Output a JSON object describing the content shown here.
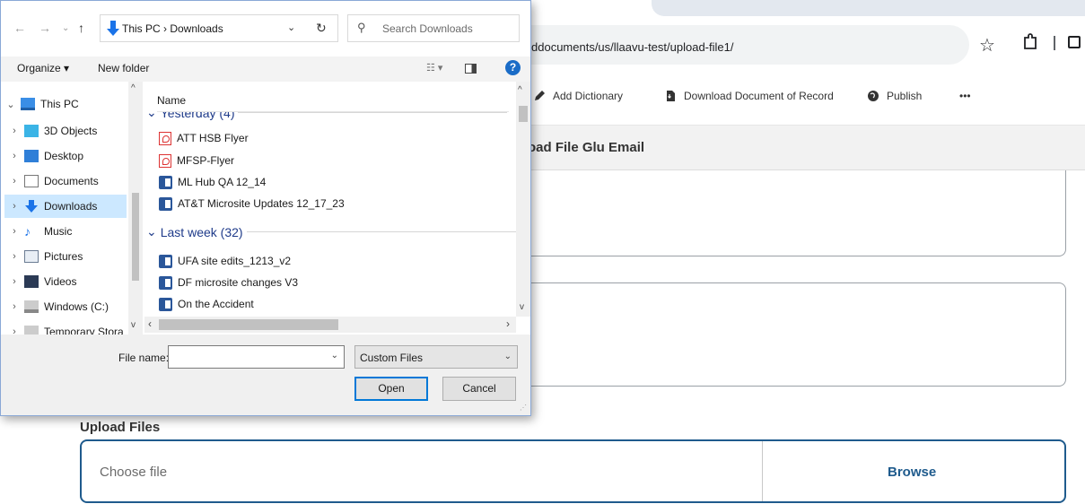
{
  "browser": {
    "url": "ddocuments/us/llaavu-test/upload-file1/",
    "toolbar": [
      {
        "label": "Add Dictionary",
        "icon": "pencil-icon"
      },
      {
        "label": "Download Document of Record",
        "icon": "document-download-icon"
      },
      {
        "label": "Publish",
        "icon": "globe-icon"
      },
      {
        "label": "•••",
        "icon": "more-icon"
      }
    ],
    "page_title": "oad File Glu Email",
    "upload_label": "Upload Files",
    "choose_file": "Choose file",
    "browse_label": "Browse"
  },
  "dialog": {
    "path": "This PC  ›  Downloads",
    "search_placeholder": "Search Downloads",
    "organize_label": "Organize ▾",
    "new_folder_label": "New folder",
    "column_name": "Name",
    "tree": [
      {
        "label": "This PC",
        "chevron": "⌄",
        "icon": "pc-icon"
      },
      {
        "label": "3D Objects",
        "chevron": "›",
        "icon": "cube-icon"
      },
      {
        "label": "Desktop",
        "chevron": "›",
        "icon": "desktop-icon"
      },
      {
        "label": "Documents",
        "chevron": "›",
        "icon": "documents-icon"
      },
      {
        "label": "Downloads",
        "chevron": "›",
        "icon": "download-icon",
        "selected": true
      },
      {
        "label": "Music",
        "chevron": "›",
        "icon": "music-icon"
      },
      {
        "label": "Pictures",
        "chevron": "›",
        "icon": "pictures-icon"
      },
      {
        "label": "Videos",
        "chevron": "›",
        "icon": "videos-icon"
      },
      {
        "label": "Windows (C:)",
        "chevron": "›",
        "icon": "drive-icon"
      },
      {
        "label": "Temporary Stora",
        "chevron": "›",
        "icon": "drive-icon"
      }
    ],
    "groups": [
      {
        "label": "Yesterday (4)"
      },
      {
        "label": "Last week (32)"
      }
    ],
    "files_yesterday": [
      {
        "name": "ATT HSB Flyer",
        "type": "pdf"
      },
      {
        "name": "MFSP-Flyer",
        "type": "pdf"
      },
      {
        "name": "ML Hub QA 12_14",
        "type": "doc"
      },
      {
        "name": "AT&T  Microsite Updates 12_17_23",
        "type": "doc"
      }
    ],
    "files_lastweek": [
      {
        "name": "UFA site edits_1213_v2",
        "type": "doc"
      },
      {
        "name": "DF microsite changes V3",
        "type": "doc"
      },
      {
        "name": "On the Accident",
        "type": "doc"
      }
    ],
    "file_name_label": "File name:",
    "file_name_value": "",
    "file_type": "Custom Files",
    "open_label": "Open",
    "cancel_label": "Cancel"
  }
}
